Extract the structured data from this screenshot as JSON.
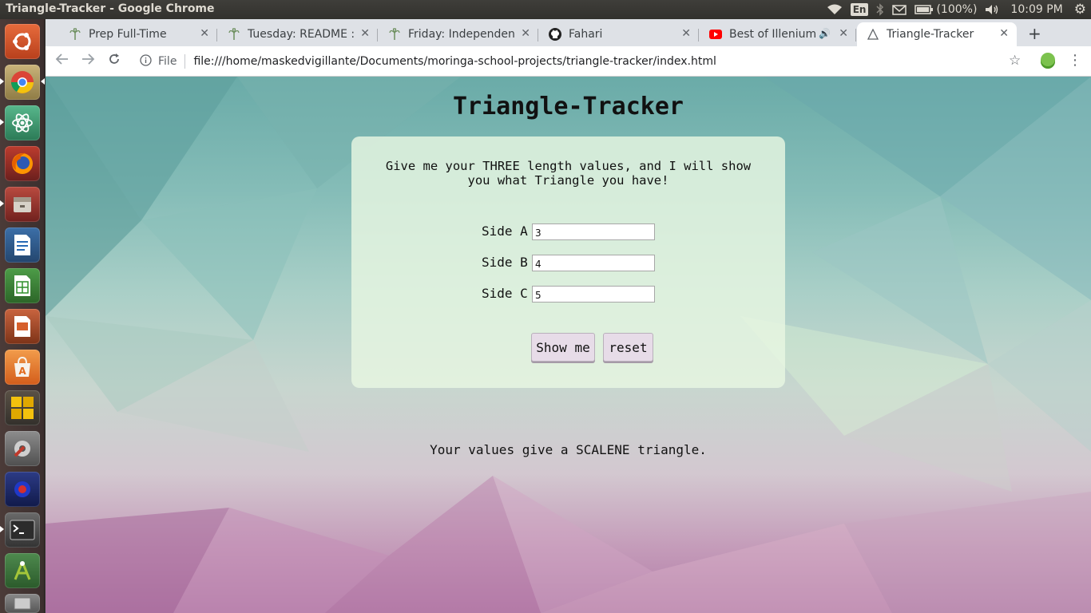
{
  "window": {
    "title": "Triangle-Tracker - Google Chrome"
  },
  "tray": {
    "wifi_icon": "wifi-icon",
    "lang": "En",
    "bluetooth_icon": "bluetooth-icon",
    "mail_icon": "mail-icon",
    "battery": "(100%)",
    "volume_icon": "volume-icon",
    "clock": "10:09 PM",
    "settings_icon": "gear-icon"
  },
  "launcher": {
    "apps": [
      "Ubuntu dash",
      "Chromium",
      "Atom",
      "Firefox",
      "Files",
      "LibreOffice Writer",
      "LibreOffice Calc",
      "LibreOffice Impress",
      "Ubuntu Software",
      "Workspace Switcher",
      "System Settings",
      "Screen Recorder",
      "Terminal",
      "Android Studio",
      "Trash"
    ]
  },
  "browser": {
    "tabs": [
      {
        "label": "Prep Full-Time",
        "icon": "moringa-icon"
      },
      {
        "label": "Tuesday: README : I",
        "icon": "moringa-icon"
      },
      {
        "label": "Friday: Independent",
        "icon": "moringa-icon"
      },
      {
        "label": "Fahari",
        "icon": "github-icon"
      },
      {
        "label": "Best of Illenium",
        "icon": "youtube-icon"
      },
      {
        "label": "Triangle-Tracker",
        "icon": "page-icon"
      }
    ],
    "address": {
      "scheme_label": "File",
      "url": "file:///home/maskedvigillante/Documents/moringa-school-projects/triangle-tracker/index.html"
    }
  },
  "page": {
    "title": "Triangle-Tracker",
    "intro": "Give me your THREE length values, and I will show you what Triangle you have!",
    "fields": [
      {
        "label": "Side A",
        "value": "3"
      },
      {
        "label": "Side B",
        "value": "4"
      },
      {
        "label": "Side C",
        "value": "5"
      }
    ],
    "show_button": "Show me",
    "reset_button": "reset",
    "result": "Your values give a SCALENE triangle."
  }
}
